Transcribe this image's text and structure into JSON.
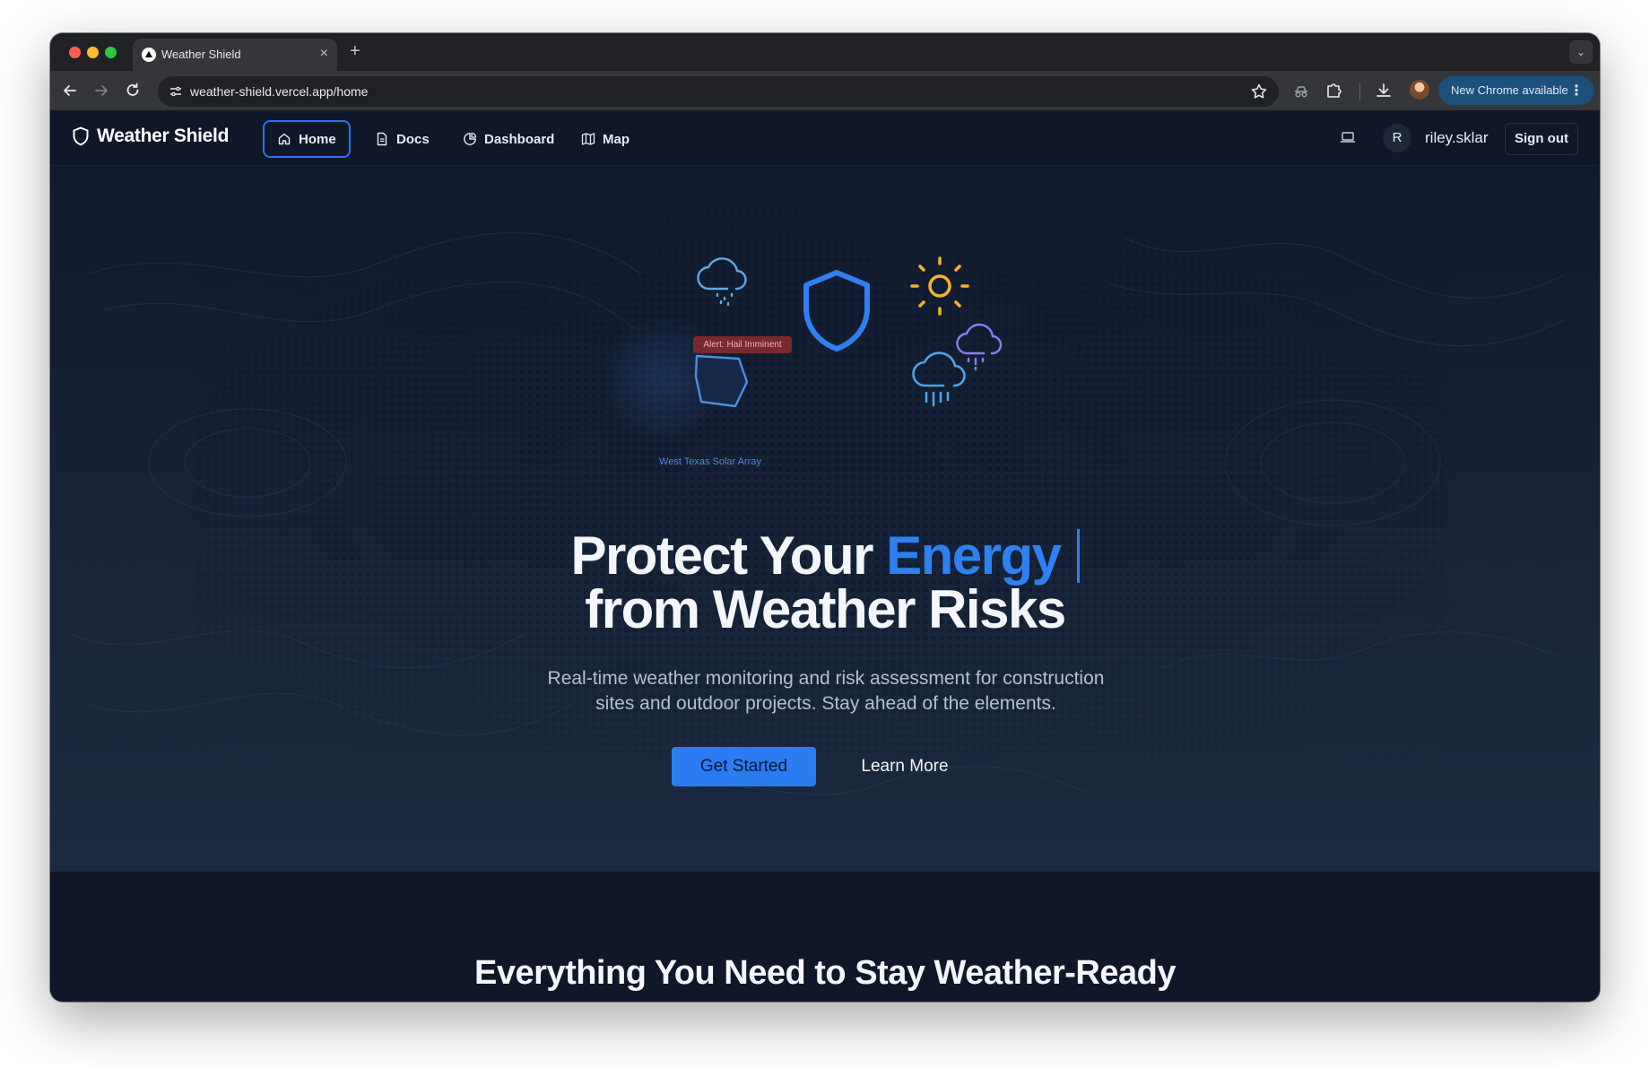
{
  "browser": {
    "tab_title": "Weather Shield",
    "url": "weather-shield.vercel.app/home",
    "update_label": "New Chrome available"
  },
  "header": {
    "brand": "Weather Shield",
    "nav": [
      {
        "label": "Home",
        "icon": "home-icon",
        "active": true
      },
      {
        "label": "Docs",
        "icon": "document-icon",
        "active": false
      },
      {
        "label": "Dashboard",
        "icon": "pie-chart-icon",
        "active": false
      },
      {
        "label": "Map",
        "icon": "map-icon",
        "active": false
      }
    ],
    "avatar_initial": "R",
    "username": "riley.sklar",
    "sign_out": "Sign out"
  },
  "hero": {
    "alert_label": "Alert: Hail Imminent",
    "site_label": "West Texas Solar Array",
    "title_line1_prefix": "Protect Your",
    "title_accent": "Energy",
    "title_line2": "from Weather Risks",
    "subtitle": "Real-time weather monitoring and risk assessment for construction sites and outdoor projects. Stay ahead of the elements.",
    "primary_cta": "Get Started",
    "secondary_cta": "Learn More"
  },
  "features": {
    "title": "Everything You Need to Stay Weather-Ready"
  },
  "colors": {
    "accent": "#2f80f0",
    "background": "#0f1729",
    "sun": "#f2b32a",
    "alert": "#7a2730"
  }
}
